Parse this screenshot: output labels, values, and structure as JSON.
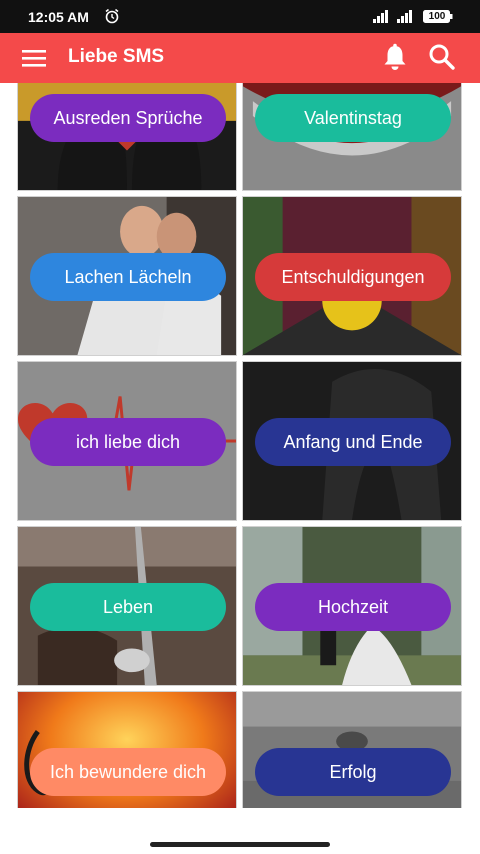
{
  "status_bar": {
    "time": "12:05 AM",
    "battery": "100",
    "alarm_icon": "alarm-clock-icon",
    "signal_icon": "signal-bars-icon",
    "battery_icon": "battery-icon"
  },
  "app_bar": {
    "title": "Liebe SMS",
    "background_color": "#f44a4a",
    "menu_icon": "hamburger-menu-icon",
    "notification_icon": "bell-icon",
    "search_icon": "search-icon"
  },
  "categories": [
    {
      "label": "Ausreden Sprüche",
      "pill_color": "#7b2cbf",
      "image": "couple-silhouette-hearts"
    },
    {
      "label": "Valentinstag",
      "pill_color": "#1abc9c",
      "image": "happy-valentines-day-sign"
    },
    {
      "label": "Lachen Lächeln",
      "pill_color": "#2e86de",
      "image": "smiling-couple"
    },
    {
      "label": "Entschuldigungen",
      "pill_color": "#d63a3a",
      "image": "sad-emoji-ball"
    },
    {
      "label": "ich liebe dich",
      "pill_color": "#7b2cbf",
      "image": "heartbeat-line"
    },
    {
      "label": "Anfang und Ende",
      "pill_color": "#283593",
      "image": "sad-woman-portrait"
    },
    {
      "label": "Leben",
      "pill_color": "#1abc9c",
      "image": "railway-track"
    },
    {
      "label": "Hochzeit",
      "pill_color": "#7b2cbf",
      "image": "wedding-couple-waterfall"
    },
    {
      "label": "Ich bewundere dich",
      "pill_color": "#ff8a65",
      "image": "sunset-music-notes"
    },
    {
      "label": "Erfolg",
      "pill_color": "#283593",
      "image": "success-couple"
    }
  ]
}
